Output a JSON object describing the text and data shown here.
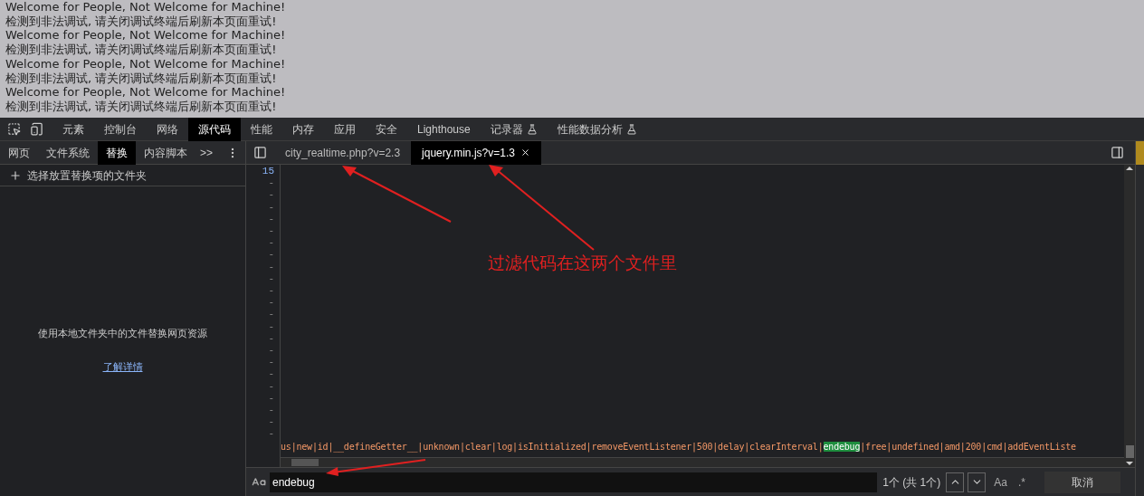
{
  "page_lines": [
    "Welcome for People, Not Welcome for Machine!",
    "检测到非法调试, 请关闭调试终端后刷新本页面重试!",
    "Welcome for People, Not Welcome for Machine!",
    "检测到非法调试, 请关闭调试终端后刷新本页面重试!",
    "Welcome for People, Not Welcome for Machine!",
    "检测到非法调试, 请关闭调试终端后刷新本页面重试!",
    "Welcome for People, Not Welcome for Machine!",
    "检测到非法调试, 请关闭调试终端后刷新本页面重试!"
  ],
  "devtools_tabs": [
    {
      "label": "元素",
      "selected": false,
      "experimental": false
    },
    {
      "label": "控制台",
      "selected": false,
      "experimental": false
    },
    {
      "label": "网络",
      "selected": false,
      "experimental": false
    },
    {
      "label": "源代码",
      "selected": true,
      "experimental": false
    },
    {
      "label": "性能",
      "selected": false,
      "experimental": false
    },
    {
      "label": "内存",
      "selected": false,
      "experimental": false
    },
    {
      "label": "应用",
      "selected": false,
      "experimental": false
    },
    {
      "label": "安全",
      "selected": false,
      "experimental": false
    },
    {
      "label": "Lighthouse",
      "selected": false,
      "experimental": false
    },
    {
      "label": "记录器",
      "selected": false,
      "experimental": true
    },
    {
      "label": "性能数据分析",
      "selected": false,
      "experimental": true
    }
  ],
  "sidebar": {
    "tabs": [
      {
        "label": "网页",
        "selected": false
      },
      {
        "label": "文件系统",
        "selected": false
      },
      {
        "label": "替换",
        "selected": true
      },
      {
        "label": "内容脚本",
        "selected": false
      }
    ],
    "more": ">>",
    "add_folder": "选择放置替换项的文件夹",
    "message": "使用本地文件夹中的文件替换网页资源",
    "link": "了解详情"
  },
  "file_tabs": [
    {
      "label": "city_realtime.php?v=2.3",
      "selected": false,
      "closable": false
    },
    {
      "label": "jquery.min.js?v=1.3",
      "selected": true,
      "closable": true
    }
  ],
  "editor": {
    "gutter": [
      "15",
      "-",
      "-",
      "-",
      "-",
      "-",
      "-",
      "-",
      "-",
      "-",
      "-",
      "-",
      "-",
      "-",
      "-",
      "-",
      "-",
      "-",
      "-",
      "-",
      "-",
      "-",
      "-"
    ],
    "code_before": "us|new|id|__defineGetter__|unknown|clear|log|isInitialized|removeEventListener|500|delay|clearInterval|",
    "match": "endebug",
    "code_after": "|free|undefined|amd|200|cmd|addEventListe"
  },
  "search": {
    "value": "endebug",
    "count": "1个 (共 1个)",
    "case_button": "Aa",
    "regex_button": ".*",
    "cancel": "取消"
  },
  "annotation": {
    "text": "过滤代码在这两个文件里"
  }
}
